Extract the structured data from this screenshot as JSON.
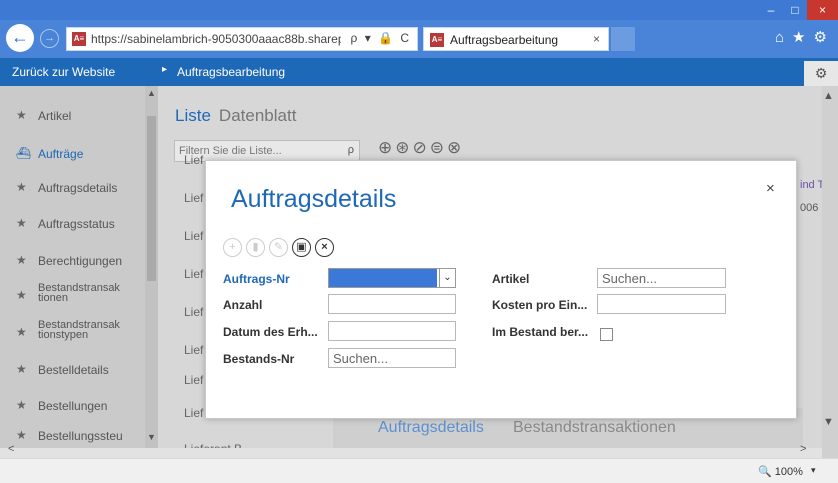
{
  "browser": {
    "url": "https://sabinelambrich-9050300aaac88b.sharepoint....",
    "url_icons": "ρ ▾ 🔒 C",
    "site_badge": "A≡",
    "tab_label": "Auftragsbearbeitung",
    "tab_close": "×",
    "back_glyph": "←",
    "fwd_glyph": "→",
    "win_min": "–",
    "win_max": "□",
    "win_close": "×",
    "tool_icons": "⌂★⚙",
    "zoom": "🔍 100%",
    "zoom_dd": "▾"
  },
  "suitebar": {
    "back_link": "Zurück zur Website",
    "separator": "▸",
    "app_title": "Auftragsbearbeitung",
    "gear_icon": "⚙"
  },
  "sidenav": {
    "items": [
      {
        "label": "Artikel",
        "icon": "★"
      },
      {
        "label": "Aufträge",
        "icon": "⛴"
      },
      {
        "label": "Auftragsdetails",
        "icon": "★"
      },
      {
        "label": "Auftragsstatus",
        "icon": "★"
      },
      {
        "label": "Berechtigungen",
        "icon": "★"
      },
      {
        "label": "Bestandstransak tionen",
        "icon": "★"
      },
      {
        "label": "Bestandstransak tionstypen",
        "icon": "★"
      },
      {
        "label": "Bestelldetails",
        "icon": "★"
      },
      {
        "label": "Bestellungen",
        "icon": "★"
      },
      {
        "label": "Bestellungssteu",
        "icon": "★"
      }
    ],
    "scroll_up": "▲",
    "scroll_dn": "▼"
  },
  "list_view": {
    "tab_list": "Liste",
    "tab_sheet": "Datenblatt",
    "search_placeholder": "Filtern Sie die Liste...",
    "search_icon": "ρ",
    "tools": "⊕⊛⊘⊜⊗",
    "rows": [
      "Lief",
      "Lief",
      "Lief",
      "Lief",
      "Lief",
      "Lief",
      "Lief",
      "Lief",
      "Lieferant B"
    ],
    "right_text_1": "ind T",
    "right_text_2": "006",
    "bottom_tab_a": "Auftragsdetails",
    "bottom_tab_b": "Bestandstransaktionen",
    "v_up": "▲",
    "v_dn": "▼",
    "h_left": "<",
    "h_right": ">"
  },
  "dialog": {
    "title": "Auftragsdetails",
    "close": "×",
    "tools": {
      "add": "+",
      "delete": "▮",
      "edit": "✎",
      "save": "▣",
      "cancel": "×"
    },
    "fields": {
      "auftrags_nr_label": "Auftrags-Nr",
      "anzahl_label": "Anzahl",
      "datum_label": "Datum des Erh...",
      "bestands_nr_label": "Bestands-Nr",
      "bestands_nr_placeholder": "Suchen...",
      "artikel_label": "Artikel",
      "artikel_placeholder": "Suchen...",
      "kosten_label": "Kosten pro Ein...",
      "im_bestand_label": "Im Bestand ber...",
      "select_arrow": "⌄"
    }
  }
}
